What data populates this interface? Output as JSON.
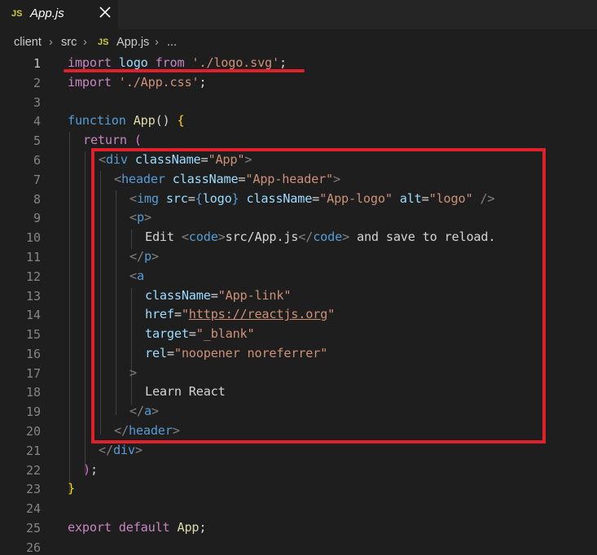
{
  "tab": {
    "badge": "JS",
    "title": "App.js"
  },
  "breadcrumb": {
    "items": [
      "client",
      "src",
      "App.js",
      "..."
    ],
    "badge": "JS"
  },
  "line_numbers": [
    "1",
    "2",
    "3",
    "4",
    "5",
    "6",
    "7",
    "8",
    "9",
    "10",
    "11",
    "12",
    "13",
    "14",
    "15",
    "16",
    "17",
    "18",
    "19",
    "20",
    "21",
    "22",
    "23",
    "24",
    "25",
    "26"
  ],
  "code": {
    "l1": {
      "import": "import",
      "logo": "logo",
      "from": "from",
      "path": "'./logo.svg'",
      "semi": ";"
    },
    "l2": {
      "import": "import",
      "path": "'./App.css'",
      "semi": ";"
    },
    "l4": {
      "function": "function",
      "name": "App",
      "parens": "()",
      "brace": "{"
    },
    "l5": {
      "return": "return",
      "paren": "("
    },
    "l6": {
      "open": "<",
      "tag": "div",
      "attr": "className",
      "eq": "=",
      "val": "\"App\"",
      "close": ">"
    },
    "l7": {
      "open": "<",
      "tag": "header",
      "attr": "className",
      "eq": "=",
      "val": "\"App-header\"",
      "close": ">"
    },
    "l8": {
      "open": "<",
      "tag": "img",
      "attr1": "src",
      "eq1": "=",
      "lb": "{",
      "var": "logo",
      "rb": "}",
      "attr2": "className",
      "eq2": "=",
      "val2": "\"App-logo\"",
      "attr3": "alt",
      "eq3": "=",
      "val3": "\"logo\"",
      "close": "/>"
    },
    "l9": {
      "open": "<",
      "tag": "p",
      "close": ">"
    },
    "l10": {
      "text1": "Edit ",
      "code_open": "<",
      "code_tag": "code",
      "code_gt": ">",
      "path": "src/App.js",
      "code_close_open": "</",
      "code_close_tag": "code",
      "code_close_gt": ">",
      "text2": " and save to reload."
    },
    "l11": {
      "open": "</",
      "tag": "p",
      "close": ">"
    },
    "l12": {
      "open": "<",
      "tag": "a"
    },
    "l13": {
      "attr": "className",
      "eq": "=",
      "val": "\"App-link\""
    },
    "l14": {
      "attr": "href",
      "eq": "=",
      "q1": "\"",
      "url": "https://reactjs.org",
      "q2": "\""
    },
    "l15": {
      "attr": "target",
      "eq": "=",
      "val": "\"_blank\""
    },
    "l16": {
      "attr": "rel",
      "eq": "=",
      "val": "\"noopener noreferrer\""
    },
    "l17": {
      "close": ">"
    },
    "l18": {
      "text": "Learn React"
    },
    "l19": {
      "open": "</",
      "tag": "a",
      "close": ">"
    },
    "l20": {
      "open": "</",
      "tag": "header",
      "close": ">"
    },
    "l21": {
      "open": "</",
      "tag": "div",
      "close": ">"
    },
    "l22": {
      "paren": ")",
      "semi": ";"
    },
    "l23": {
      "brace": "}"
    },
    "l25": {
      "export": "export",
      "default": "default",
      "name": "App",
      "semi": ";"
    }
  },
  "colors": {
    "annotation_red": "#e0202a",
    "background": "#1e1e1e"
  },
  "icons": {
    "tab_close": "close-icon",
    "breadcrumb_sep": "chevron-right-icon"
  }
}
